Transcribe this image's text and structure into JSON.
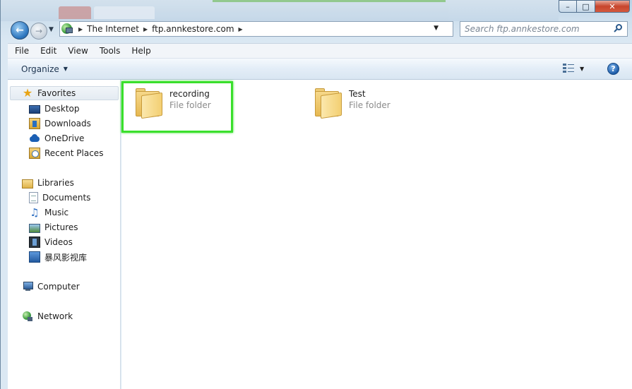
{
  "window": {
    "caption_buttons": {
      "minimize": "–",
      "maximize": "□",
      "close": "✕"
    }
  },
  "address_bar": {
    "crumbs": [
      "The Internet",
      "ftp.annkestore.com"
    ]
  },
  "search": {
    "placeholder": "Search ftp.annkestore.com"
  },
  "menu": [
    "File",
    "Edit",
    "View",
    "Tools",
    "Help"
  ],
  "commandbar": {
    "organize_label": "Organize"
  },
  "navpane": {
    "favorites": {
      "label": "Favorites",
      "items": [
        "Desktop",
        "Downloads",
        "OneDrive",
        "Recent Places"
      ]
    },
    "libraries": {
      "label": "Libraries",
      "items": [
        "Documents",
        "Music",
        "Pictures",
        "Videos",
        "暴风影视库"
      ]
    },
    "computer": {
      "label": "Computer"
    },
    "network": {
      "label": "Network"
    }
  },
  "content": {
    "items": [
      {
        "name": "recording",
        "type": "File folder"
      },
      {
        "name": "Test",
        "type": "File folder"
      }
    ]
  },
  "colors": {
    "highlight": "#3adf2c",
    "secondary_text": "#8b8b8b"
  }
}
